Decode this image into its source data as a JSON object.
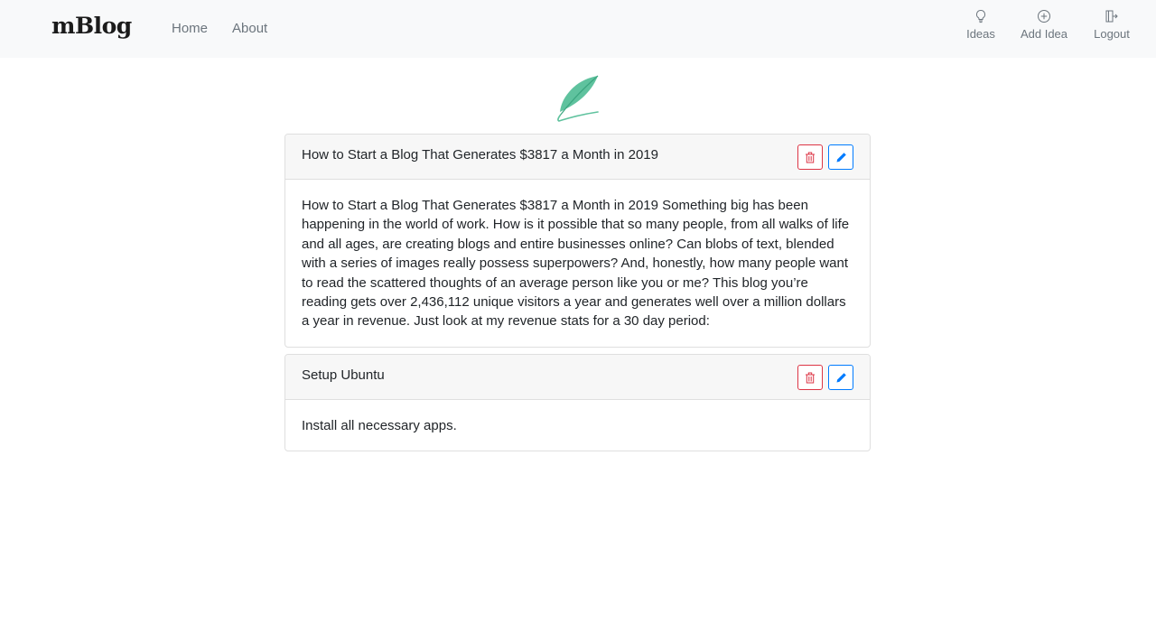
{
  "navbar": {
    "brand": "mBlog",
    "links": [
      {
        "label": "Home"
      },
      {
        "label": "About"
      }
    ],
    "actions": [
      {
        "label": "Ideas",
        "icon": "lightbulb-icon"
      },
      {
        "label": "Add Idea",
        "icon": "plus-circle-icon"
      },
      {
        "label": "Logout",
        "icon": "logout-icon"
      }
    ]
  },
  "logo": {
    "icon": "feather-icon",
    "color": "#5fc29e"
  },
  "ideas": [
    {
      "title": "How to Start a Blog That Generates $3817 a Month in 2019",
      "body": "How to Start a Blog That Generates $3817 a Month in 2019 Something big has been happening in the world of work. How is it possible that so many people, from all walks of life and all ages, are creating blogs and entire businesses online? Can blobs of text, blended with a series of images really possess superpowers? And, honestly, how many people want to read the scattered thoughts of an average person like you or me? This blog you’re reading gets over 2,436,112 unique visitors a year and generates well over a million dollars a year in revenue. Just look at my revenue stats for a 30 day period:"
    },
    {
      "title": "Setup Ubuntu",
      "body": "Install all necessary apps."
    }
  ],
  "colors": {
    "danger": "#dc3545",
    "primary": "#007bff",
    "muted": "#6c757d"
  }
}
